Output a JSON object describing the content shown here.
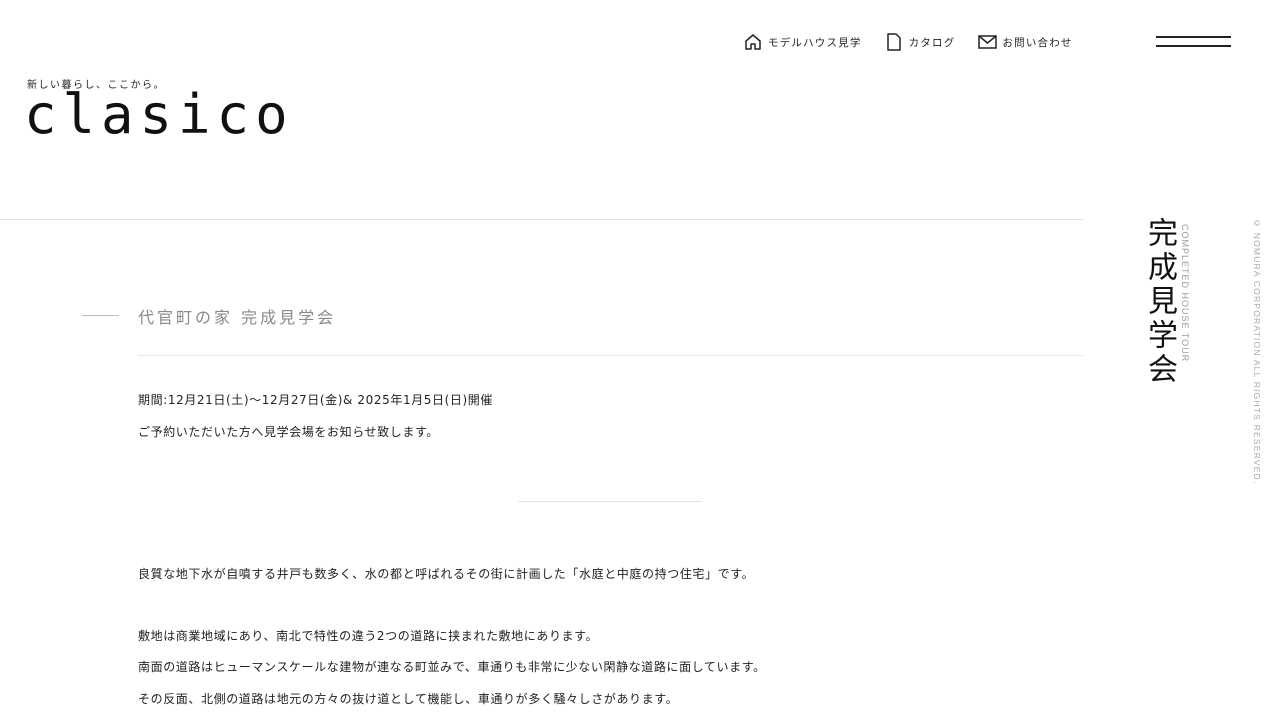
{
  "header": {
    "nav": [
      {
        "label": "モデルハウス見学",
        "icon": "house-icon"
      },
      {
        "label": "カタログ",
        "icon": "document-icon"
      },
      {
        "label": "お問い合わせ",
        "icon": "mail-icon"
      }
    ],
    "menu_icon": "hamburger-menu-icon"
  },
  "brand": {
    "tagline": "新しい暮らし、ここから。",
    "logo": "clasico"
  },
  "side": {
    "title": "完成見学会",
    "subtitle": "COMPLETED HOUSE TOUR",
    "copyright": "© NOMURA CORPORATION ALL RIGHTS RESERVED."
  },
  "event": {
    "title": "代官町の家 完成見学会",
    "period": "期間:12月21日(土)〜12月27日(金)& 2025年1月5日(日)開催",
    "notice": "ご予約いただいた方へ見学会場をお知らせ致します。"
  },
  "body": {
    "p1": "良質な地下水が自噴する井戸も数多く、水の都と呼ばれるその街に計画した「水庭と中庭の持つ住宅」です。",
    "p2": "敷地は商業地域にあり、南北で特性の違う2つの道路に挟まれた敷地にあります。",
    "p3": "南面の道路はヒューマンスケールな建物が連なる町並みで、車通りも非常に少ない閑静な道路に面しています。",
    "p4": "その反面、北側の道路は地元の方々の抜け道として機能し、車通りが多く騒々しさがあります。"
  },
  "colors": {
    "text": "#222222",
    "muted": "#8a8a8a",
    "rule": "#e3e3e3"
  }
}
